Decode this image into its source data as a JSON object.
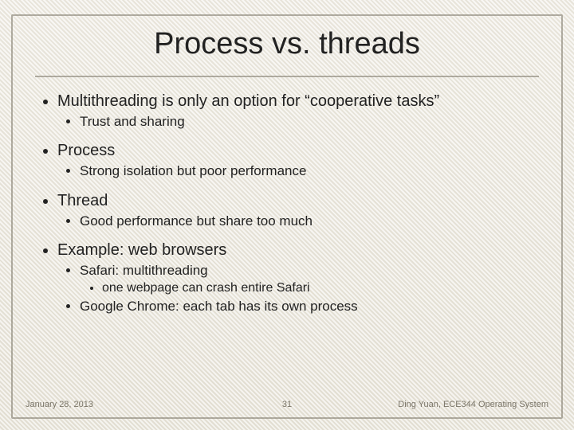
{
  "title": "Process vs. threads",
  "bullets": {
    "b1": "Multithreading is only an option for “cooperative tasks”",
    "b1a": "Trust and sharing",
    "b2": "Process",
    "b2a": "Strong isolation but poor performance",
    "b3": "Thread",
    "b3a": "Good performance but share too much",
    "b4": "Example: web browsers",
    "b4a": "Safari: multithreading",
    "b4a1": "one webpage can crash entire Safari",
    "b4b": "Google Chrome: each tab has its own process"
  },
  "footer": {
    "date": "January 28, 2013",
    "page": "31",
    "credit": "Ding Yuan, ECE344 Operating System"
  }
}
